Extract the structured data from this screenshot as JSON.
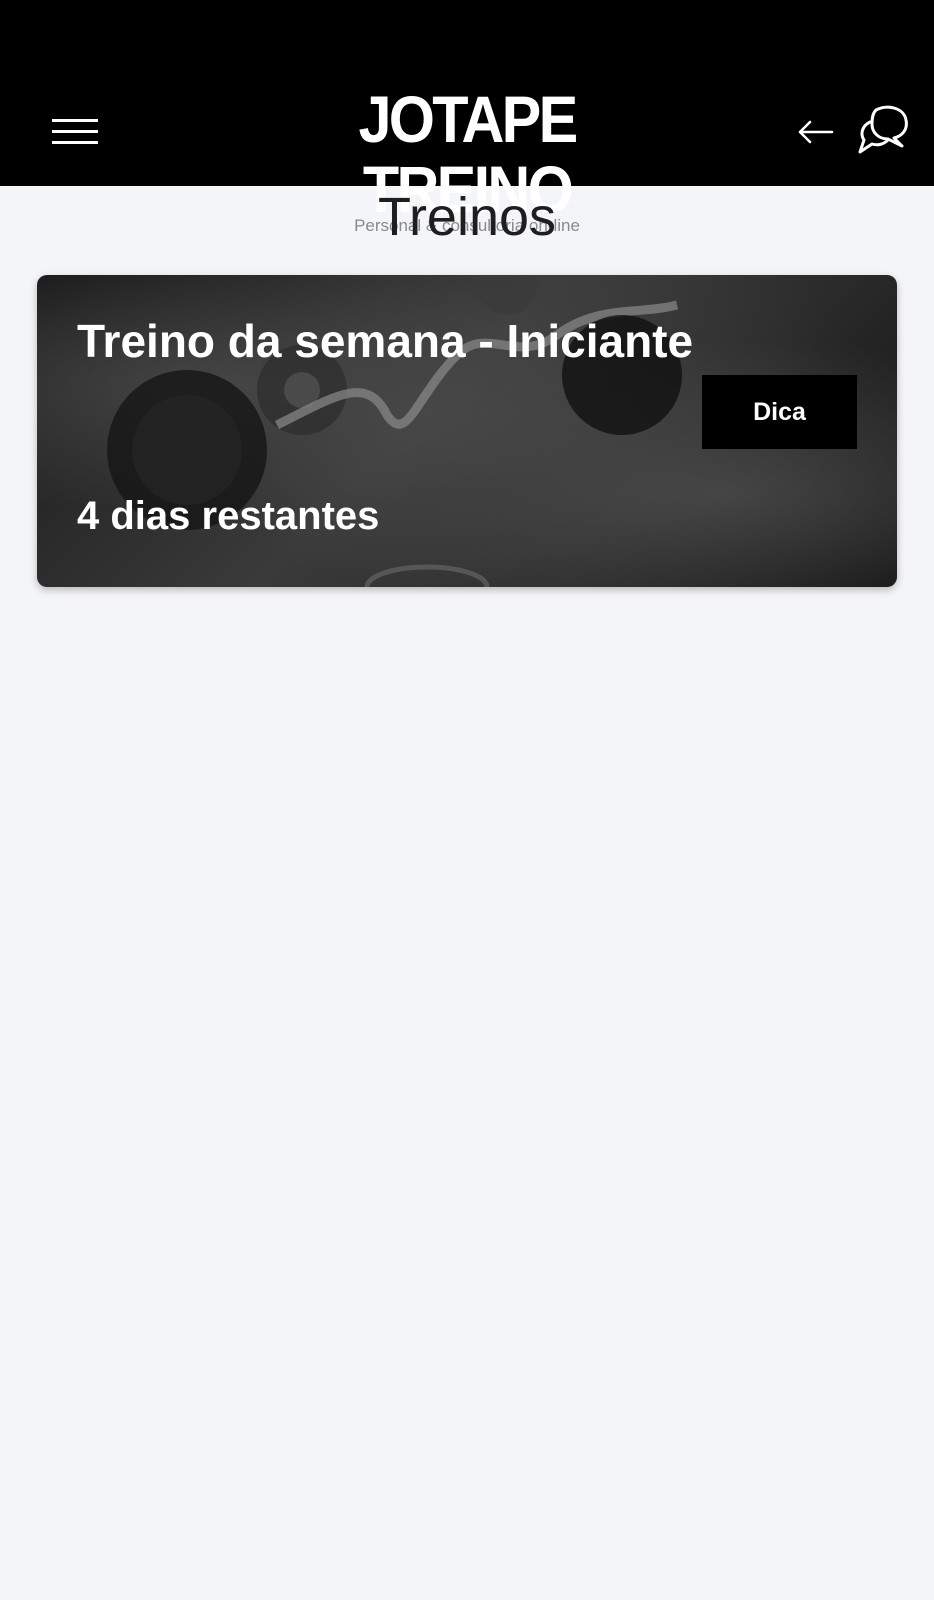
{
  "header": {
    "logo_title": "JOTAPE TREINO",
    "logo_subtitle": "Personal & consultoria on-line",
    "menu_icon": "hamburger-menu-icon",
    "back_icon": "arrow-left-icon",
    "chat_icon": "chat-bubbles-icon",
    "background_color": "#000000"
  },
  "page": {
    "title": "Treinos",
    "background_color": "#f4f5f9"
  },
  "workouts": [
    {
      "title": "Treino da semana - Iniciante",
      "remaining": "4 dias restantes",
      "tip_label": "Dica"
    }
  ]
}
